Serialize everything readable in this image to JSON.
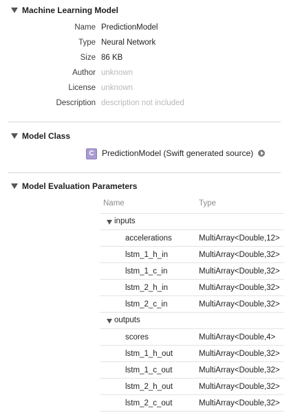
{
  "model_section": {
    "title": "Machine Learning Model",
    "properties": [
      {
        "key": "Name",
        "value": "PredictionModel",
        "muted": false
      },
      {
        "key": "Type",
        "value": "Neural Network",
        "muted": false
      },
      {
        "key": "Size",
        "value": "86 KB",
        "muted": false
      },
      {
        "key": "Author",
        "value": "unknown",
        "muted": true
      },
      {
        "key": "License",
        "value": "unknown",
        "muted": true
      },
      {
        "key": "Description",
        "value": "description not included",
        "muted": true
      }
    ]
  },
  "class_section": {
    "title": "Model Class",
    "badge": "C",
    "label": "PredictionModel (Swift generated source)"
  },
  "eval_section": {
    "title": "Model Evaluation Parameters",
    "columns": {
      "name": "Name",
      "type": "Type"
    },
    "groups": [
      {
        "label": "inputs",
        "rows": [
          {
            "name": "accelerations",
            "type": "MultiArray<Double,12>"
          },
          {
            "name": "lstm_1_h_in",
            "type": "MultiArray<Double,32>"
          },
          {
            "name": "lstm_1_c_in",
            "type": "MultiArray<Double,32>"
          },
          {
            "name": "lstm_2_h_in",
            "type": "MultiArray<Double,32>"
          },
          {
            "name": "lstm_2_c_in",
            "type": "MultiArray<Double,32>"
          }
        ]
      },
      {
        "label": "outputs",
        "rows": [
          {
            "name": "scores",
            "type": "MultiArray<Double,4>"
          },
          {
            "name": "lstm_1_h_out",
            "type": "MultiArray<Double,32>"
          },
          {
            "name": "lstm_1_c_out",
            "type": "MultiArray<Double,32>"
          },
          {
            "name": "lstm_2_h_out",
            "type": "MultiArray<Double,32>"
          },
          {
            "name": "lstm_2_c_out",
            "type": "MultiArray<Double,32>"
          }
        ]
      }
    ]
  }
}
